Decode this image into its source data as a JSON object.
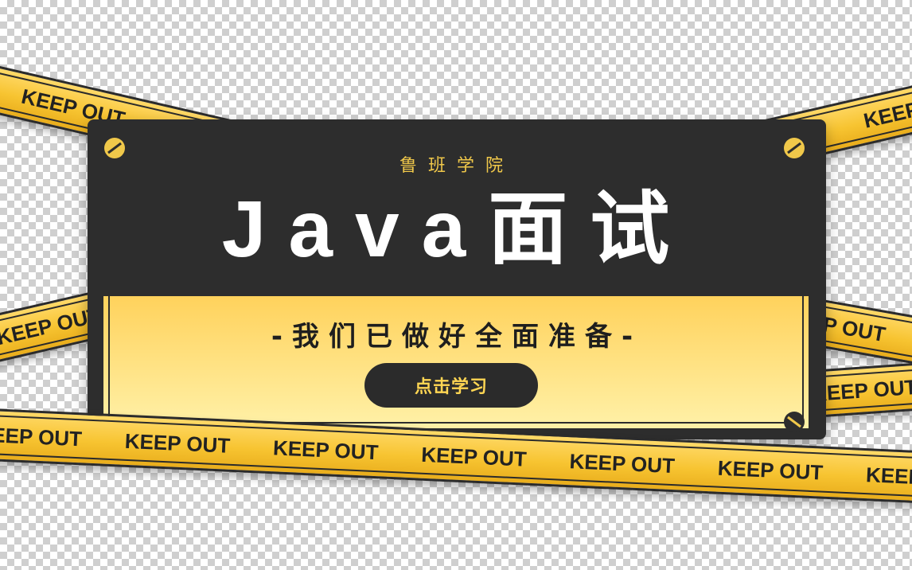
{
  "brand": "鲁班学院",
  "title": "Java面试",
  "subtitle": "-我们已做好全面准备-",
  "cta_label": "点击学习",
  "tape_text": "KEEP OUT",
  "colors": {
    "tape_yellow": "#f7c431",
    "card_dark": "#2d2d2d",
    "brand_gold": "#f0c84a",
    "inner_yellow": "#ffd25c"
  },
  "icons": [
    "screw-icon"
  ]
}
